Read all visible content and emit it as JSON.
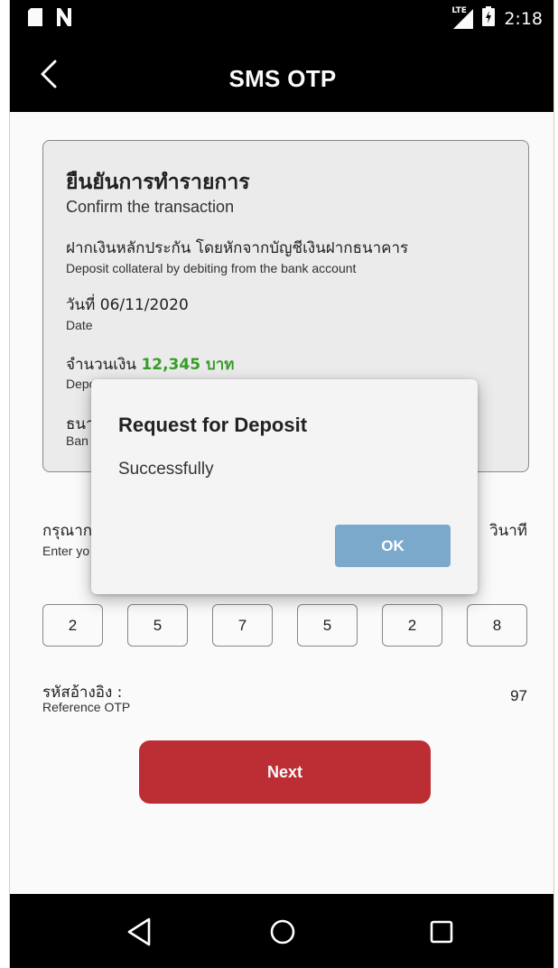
{
  "status_bar": {
    "time": "2:18",
    "network": "LTE",
    "icons": [
      "sd-card-icon",
      "n-icon",
      "signal-icon",
      "battery-icon"
    ]
  },
  "app_bar": {
    "title": "SMS OTP",
    "back_icon": "chevron-left-icon"
  },
  "card": {
    "heading_th": "ยืนยันการทำรายการ",
    "heading_en": "Confirm the transaction",
    "rows": [
      {
        "th": "ฝากเงินหลักประกัน โดยหักจากบัญชีเงินฝากธนาคาร",
        "en": "Deposit collateral by debiting from the bank account"
      },
      {
        "th": "วันที่ 06/11/2020",
        "en": "Date"
      },
      {
        "th_prefix": "จำนวนเงิน",
        "amount": "12,345 บาท",
        "en": "Depo"
      },
      {
        "th": "ธนา",
        "en": "Ban"
      }
    ]
  },
  "otp": {
    "label_th": "กรุณาก",
    "label_en": "Enter yo",
    "timer_th": "วินาที",
    "digits": [
      "2",
      "5",
      "7",
      "5",
      "2",
      "8"
    ]
  },
  "reference": {
    "label_th": "รหัสอ้างอิง :",
    "label_en": "Reference OTP",
    "value": "97"
  },
  "next_button": {
    "label": "Next"
  },
  "dialog": {
    "title": "Request for Deposit",
    "message": "Successfully",
    "ok_label": "OK"
  },
  "nav": {
    "items": [
      "back-triangle-icon",
      "home-circle-icon",
      "recents-square-icon"
    ]
  },
  "colors": {
    "bars": "#000000",
    "card_bg": "#f0f0f0",
    "amount": "#3aa02a",
    "next_button": "#c02f36",
    "ok_button": "#7aa9cc"
  }
}
